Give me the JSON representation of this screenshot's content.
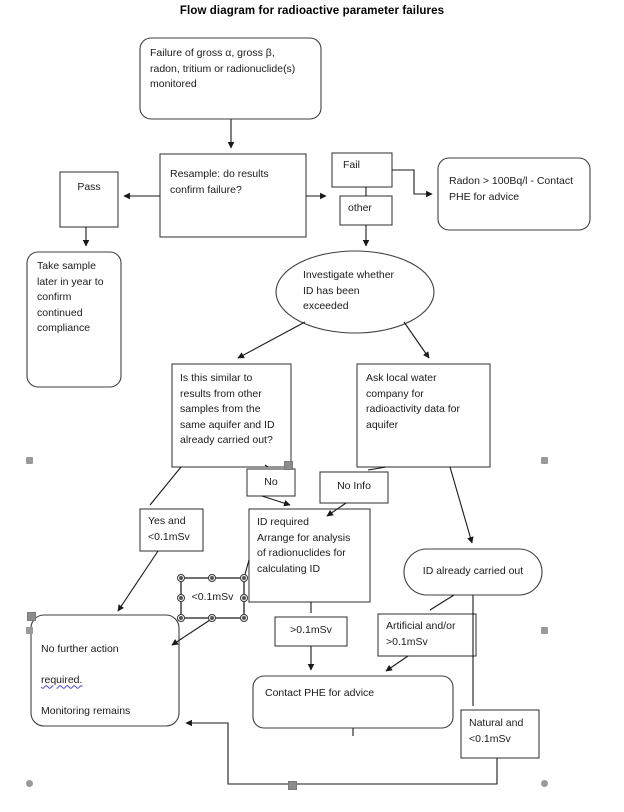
{
  "title": "Flow diagram for radioactive parameter failures",
  "theme": {
    "background": "#ffffff",
    "shape_stroke": "#3f3f3f",
    "connector_stroke": "#1a1a1a",
    "text": "#1b1b1b",
    "selection_handle": "#8c8c8c",
    "spellcheck_underline": "#4646d2"
  },
  "nodes": {
    "start": {
      "label": "Failure of gross α, gross β,\nradon, tritium or radionuclide(s)\nmonitored",
      "shape": "rounded-rectangle"
    },
    "resample": {
      "label": "Resample: do results\nconfirm failure?",
      "shape": "rectangle"
    },
    "pass": {
      "label": "Pass",
      "shape": "rectangle"
    },
    "fail": {
      "label": "Fail",
      "shape": "rectangle"
    },
    "other": {
      "label": "other",
      "shape": "rectangle"
    },
    "radon": {
      "label": "Radon > 100Bq/l - Contact\nPHE for advice",
      "shape": "rounded-rectangle"
    },
    "take_sample": {
      "label": "Take sample\nlater in year to\nconfirm\ncontinued\ncompliance",
      "shape": "rounded-rectangle"
    },
    "investigate": {
      "label": "Investigate whether\nID has been\nexceeded",
      "shape": "ellipse"
    },
    "similar": {
      "label": "Is this similar to\nresults from other\nsamples from the\nsame aquifer and ID\nalready carried out?",
      "shape": "rectangle"
    },
    "ask_water": {
      "label": "Ask local water\ncompany for\nradioactivity data for\naquifer",
      "shape": "rectangle"
    },
    "no": {
      "label": "No",
      "shape": "rectangle"
    },
    "no_info": {
      "label": "No Info",
      "shape": "rectangle"
    },
    "yes_and": {
      "label": "Yes and\n<0.1mSv",
      "shape": "rectangle"
    },
    "id_required": {
      "label": "ID required\nArrange for analysis\nof radionuclides for\ncalculating ID",
      "shape": "rectangle"
    },
    "id_carried": {
      "label": "ID already carried out",
      "shape": "stadium"
    },
    "lt_msv_selected": {
      "label": "<0.1mSv",
      "shape": "rectangle",
      "selected": true
    },
    "gt_msv": {
      "label": ">0.1mSv",
      "shape": "rectangle"
    },
    "artificial": {
      "label": "Artificial and/or\n>0.1mSv",
      "shape": "rectangle"
    },
    "natural": {
      "label": "Natural and\n<0.1mSv",
      "shape": "rectangle"
    },
    "no_action": {
      "label_line1": "No further action",
      "label_line2": "required.",
      "label_line3": "Monitoring remains",
      "shape": "rounded-rectangle"
    },
    "contact_phe": {
      "label": "Contact PHE for advice",
      "shape": "rounded-rectangle"
    }
  },
  "edges": [
    {
      "from": "start",
      "to": "resample",
      "label": ""
    },
    {
      "from": "resample",
      "to": "pass",
      "label": ""
    },
    {
      "from": "resample",
      "to": "fail",
      "label": ""
    },
    {
      "from": "fail",
      "to": "radon",
      "label": ""
    },
    {
      "from": "other",
      "to": "investigate",
      "label": ""
    },
    {
      "from": "pass",
      "to": "take_sample",
      "label": ""
    },
    {
      "from": "investigate",
      "to": "similar",
      "label": ""
    },
    {
      "from": "investigate",
      "to": "ask_water",
      "label": ""
    },
    {
      "from": "similar",
      "to": "yes_and",
      "label": ""
    },
    {
      "from": "similar",
      "to": "no",
      "label": ""
    },
    {
      "from": "no",
      "to": "id_required",
      "label": ""
    },
    {
      "from": "ask_water",
      "to": "no_info",
      "label": ""
    },
    {
      "from": "no_info",
      "to": "id_required",
      "label": ""
    },
    {
      "from": "ask_water",
      "to": "id_carried",
      "label": ""
    },
    {
      "from": "yes_and",
      "to": "no_action",
      "label": ""
    },
    {
      "from": "lt_msv_selected",
      "to": "no_action",
      "label": ""
    },
    {
      "from": "id_required",
      "to": "gt_msv",
      "label": ""
    },
    {
      "from": "gt_msv",
      "to": "contact_phe",
      "label": ""
    },
    {
      "from": "id_carried",
      "to": "artificial",
      "label": ""
    },
    {
      "from": "artificial",
      "to": "contact_phe",
      "label": ""
    },
    {
      "from": "id_carried",
      "to": "natural",
      "label": ""
    },
    {
      "from": "natural",
      "to": "no_action",
      "label": ""
    }
  ]
}
